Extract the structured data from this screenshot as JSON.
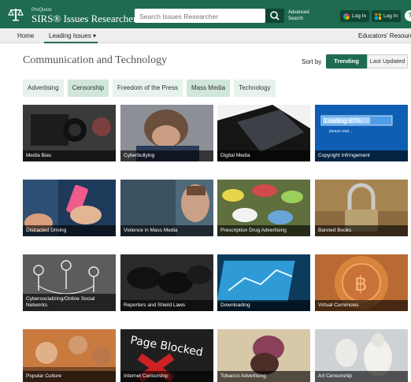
{
  "header": {
    "brand_small": "ProQuest",
    "brand": "SIRS® Issues Researcher",
    "search_placeholder": "Search Issues Researcher",
    "advanced_line1": "Advanced",
    "advanced_line2": "Search",
    "google_login": "Log In",
    "microsoft_login": "Log In",
    "help": "?"
  },
  "nav": {
    "home": "Home",
    "leading_issues": "Leading Issues ▾",
    "educators": "Educators' Resources"
  },
  "page": {
    "title": "Communication and Technology",
    "sort_label": "Sort by",
    "sort_trending": "Trending",
    "sort_last_updated": "Last Updated"
  },
  "chips": [
    {
      "label": "Advertising",
      "active": false
    },
    {
      "label": "Censorship",
      "active": true
    },
    {
      "label": "Freedom of the Press",
      "active": false
    },
    {
      "label": "Mass Media",
      "active": true
    },
    {
      "label": "Technology",
      "active": false
    }
  ],
  "tiles": [
    {
      "label": "Media Bias"
    },
    {
      "label": "Cyberbullying"
    },
    {
      "label": "Digital Media"
    },
    {
      "label": "Copyright Infringement",
      "overlay_text": "Loading 67%",
      "overlay_sub": "please wait..."
    },
    {
      "label": "Distracted Driving"
    },
    {
      "label": "Violence in Mass Media"
    },
    {
      "label": "Prescription Drug Advertising"
    },
    {
      "label": "Banned Books"
    },
    {
      "label": "Cybersocializing/Online Social Networks"
    },
    {
      "label": "Reporters and Shield Laws"
    },
    {
      "label": "Downloading"
    },
    {
      "label": "Virtual Currencies"
    },
    {
      "label": "Popular Culture"
    },
    {
      "label": "Internet Censorship",
      "overlay_text": "Page Blocked"
    },
    {
      "label": "Tobacco Advertising"
    },
    {
      "label": "Art Censorship"
    }
  ],
  "colors": {
    "brand_green": "#1f6b50",
    "dark_green": "#0f4532",
    "chip_bg": "#e6f2ec"
  }
}
